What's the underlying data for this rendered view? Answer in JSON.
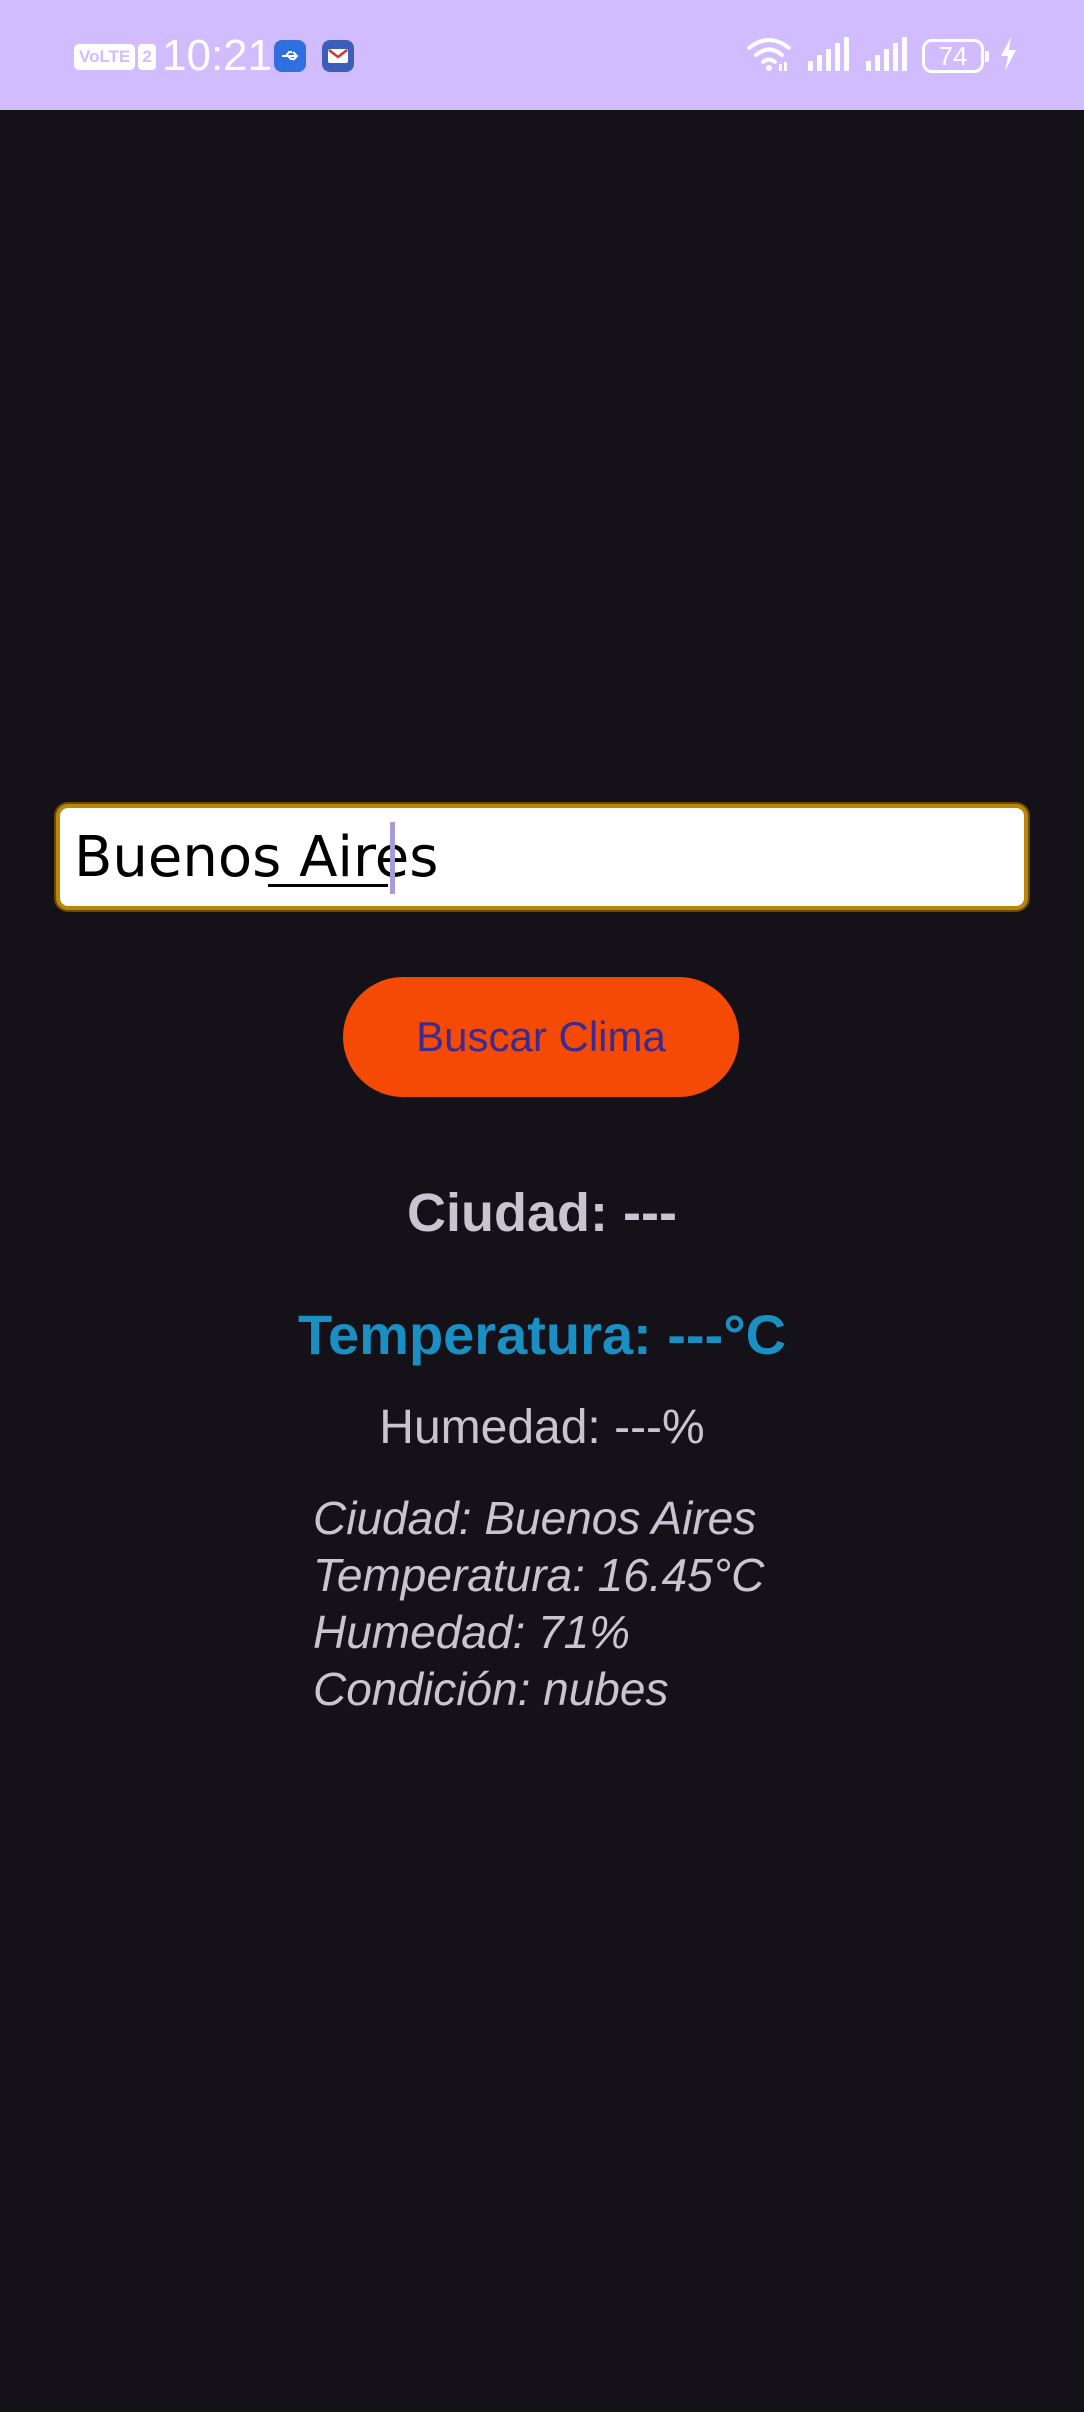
{
  "status_bar": {
    "volte": "VoLTE",
    "sim": "2",
    "time": "10:21",
    "battery": "74",
    "colors": {
      "background": "#d0bcff",
      "foreground": "#ffffff"
    },
    "icons": [
      "usb-icon",
      "gmail-icon",
      "wifi-icon",
      "signal-icon",
      "signal-icon",
      "battery-icon",
      "charging-icon"
    ]
  },
  "search": {
    "value": "Buenos Aires",
    "button_label": "Buscar Clima"
  },
  "weather": {
    "city_heading": "Ciudad: ---",
    "temperature_heading": "Temperatura: ---°C",
    "humidity_heading": "Humedad: ---%",
    "result_lines": [
      "Ciudad: Buenos Aires",
      "Temperatura: 16.45°C",
      "Humedad: 71%",
      "Condición: nubes"
    ]
  },
  "colors": {
    "background": "#141218",
    "button": "#f44a06",
    "button_text": "#3b2a8f",
    "temperature_accent": "#1a8fc4",
    "text": "#cac4d0"
  }
}
